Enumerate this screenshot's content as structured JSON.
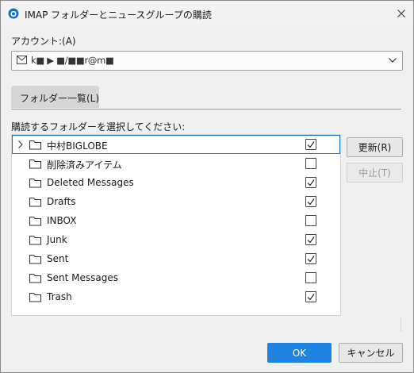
{
  "window": {
    "title": "IMAP フォルダーとニュースグループの購読"
  },
  "account": {
    "label": "アカウント:(A)",
    "value": "k■ ▶ ■/■■r@m■"
  },
  "tab": {
    "label": "フォルダー一覧(L)"
  },
  "instruction": "購読するフォルダーを選択してください:",
  "folders": [
    {
      "name": "中村BIGLOBE",
      "checked": true,
      "expandable": true,
      "selected": true
    },
    {
      "name": "削除済みアイテム",
      "checked": false
    },
    {
      "name": "Deleted Messages",
      "checked": true
    },
    {
      "name": "Drafts",
      "checked": true
    },
    {
      "name": "INBOX",
      "checked": false
    },
    {
      "name": "Junk",
      "checked": true
    },
    {
      "name": "Sent",
      "checked": true
    },
    {
      "name": "Sent Messages",
      "checked": false
    },
    {
      "name": "Trash",
      "checked": true
    }
  ],
  "buttons": {
    "refresh": "更新(R)",
    "stop": "中止(T)",
    "ok": "OK",
    "cancel": "キャンセル"
  },
  "colors": {
    "accent": "#1e83e1",
    "selection_border": "#1874d2"
  }
}
